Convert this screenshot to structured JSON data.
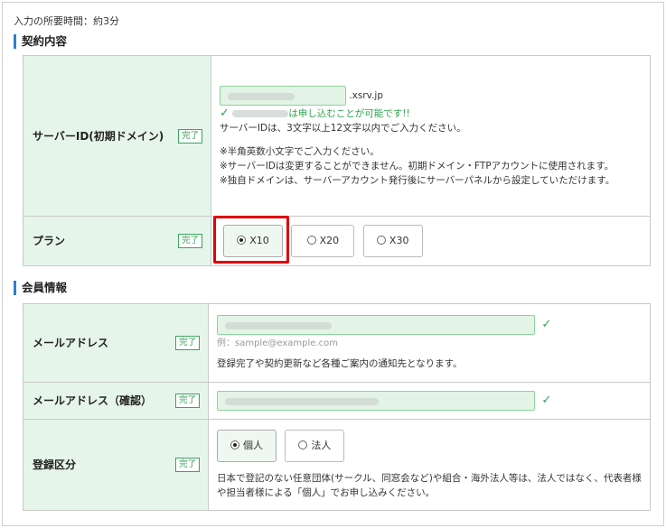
{
  "intro": "入力の所要時間：約3分",
  "contract": {
    "heading": "契約内容",
    "done_label": "完了",
    "server_id": {
      "label": "サーバーID(初期ドメイン)",
      "domain_suffix": ".xsrv.jp",
      "available_msg": "は申し込むことが可能です!!",
      "help": "サーバーIDは、3文字以上12文字以内でご入力ください。",
      "notes": [
        "※半角英数小文字でご入力ください。",
        "※サーバーIDは変更することができません。初期ドメイン・FTPアカウントに使用されます。",
        "※独自ドメインは、サーバーアカウント発行後にサーバーパネルから設定していただけます。"
      ]
    },
    "plan": {
      "label": "プラン",
      "options": [
        "X10",
        "X20",
        "X30"
      ],
      "selected": "X10"
    }
  },
  "member": {
    "heading": "会員情報",
    "email": {
      "label": "メールアドレス",
      "placeholder_hint": "例：sample@example.com",
      "help": "登録完了や契約更新など各種ご案内の通知先となります。"
    },
    "email_confirm": {
      "label": "メールアドレス（確認）"
    },
    "reg_type": {
      "label": "登録区分",
      "options": [
        "個人",
        "法人"
      ],
      "selected": "個人",
      "help": "日本で登記のない任意団体(サークル、同窓会など)や組合・海外法人等は、法人ではなく、代表者様や担当者様による「個人」でお申し込みください。"
    }
  },
  "colors": {
    "accent": "#2f7fd0",
    "label_bg": "#e6f5ea",
    "success": "#2ea44f",
    "highlight": "#e00000"
  }
}
